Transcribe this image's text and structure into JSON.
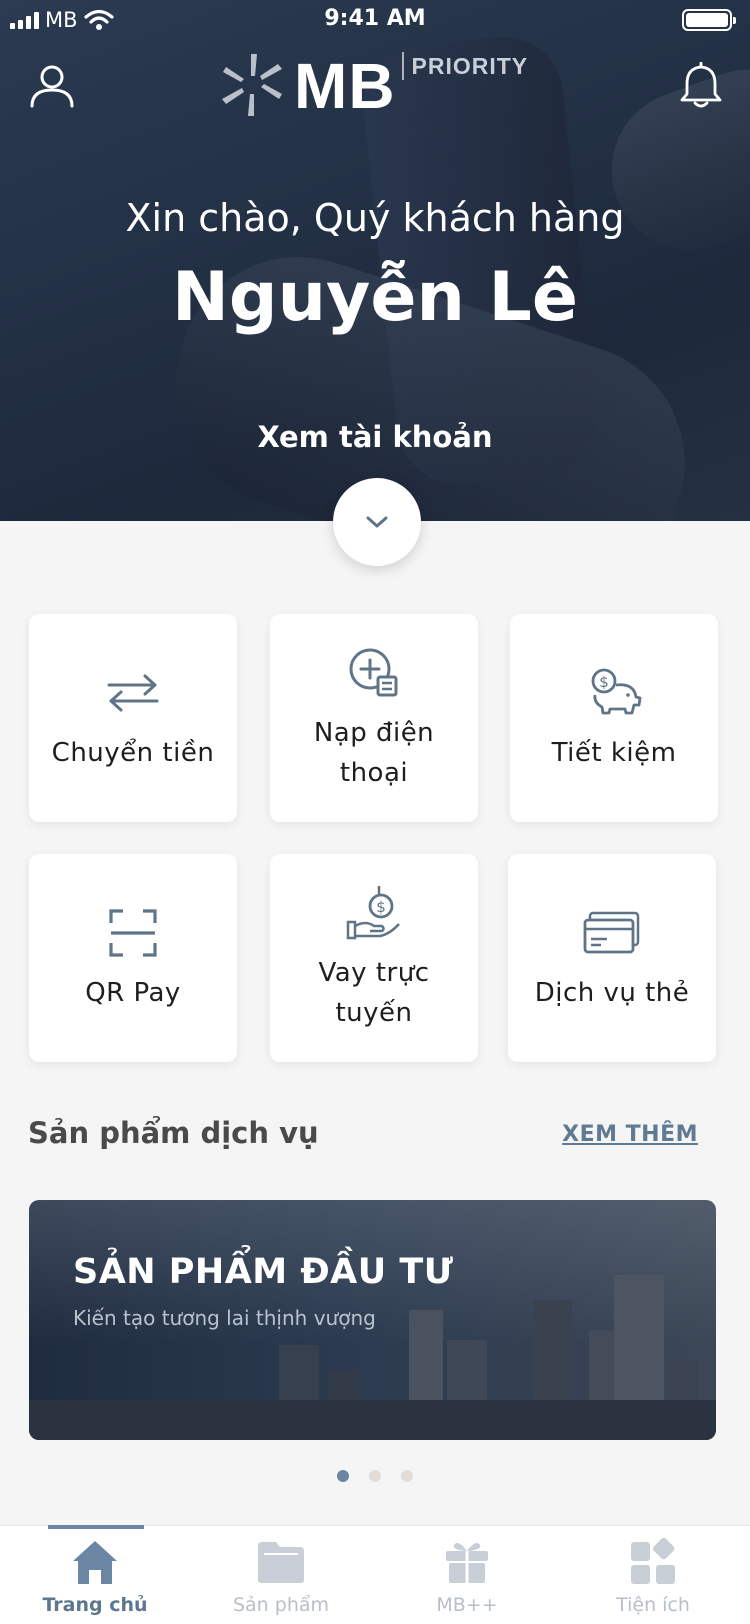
{
  "status_bar": {
    "carrier": "MB",
    "time": "9:41 AM"
  },
  "header": {
    "logo_text": "MB",
    "logo_badge": "PRIORITY",
    "greeting": "Xin chào, Quý khách hàng",
    "user_name": "Nguyễn Lê",
    "view_account": "Xem tài khoản"
  },
  "quick_actions": [
    {
      "label": "Chuyển tiền",
      "icon": "transfer-arrows-icon"
    },
    {
      "label": "Nạp điện thoại",
      "icon": "topup-plus-icon"
    },
    {
      "label": "Tiết kiệm",
      "icon": "piggy-bank-icon"
    },
    {
      "label": "QR Pay",
      "icon": "qr-scan-icon"
    },
    {
      "label": "Vay trực tuyến",
      "icon": "loan-hand-coin-icon"
    },
    {
      "label": "Dịch vụ thẻ",
      "icon": "card-icon"
    }
  ],
  "products_section": {
    "title": "Sản phẩm dịch vụ",
    "more_label": "XEM THÊM"
  },
  "banner": {
    "title": "SẢN PHẨM ĐẦU TƯ",
    "subtitle": "Kiến tạo tương lai thịnh vượng",
    "page_count": 3,
    "active_page": 1
  },
  "tabbar": [
    {
      "label": "Trang chủ",
      "icon": "home-icon",
      "active": true
    },
    {
      "label": "Sản phẩm",
      "icon": "folder-icon",
      "active": false
    },
    {
      "label": "MB++",
      "icon": "gift-icon",
      "active": false
    },
    {
      "label": "Tiện ích",
      "icon": "utilities-grid-icon",
      "active": false
    }
  ],
  "colors": {
    "hero_bg": "#243247",
    "accent": "#6b86a3",
    "tile_icon": "#5f7487",
    "tab_inactive": "#b7bfc8"
  }
}
